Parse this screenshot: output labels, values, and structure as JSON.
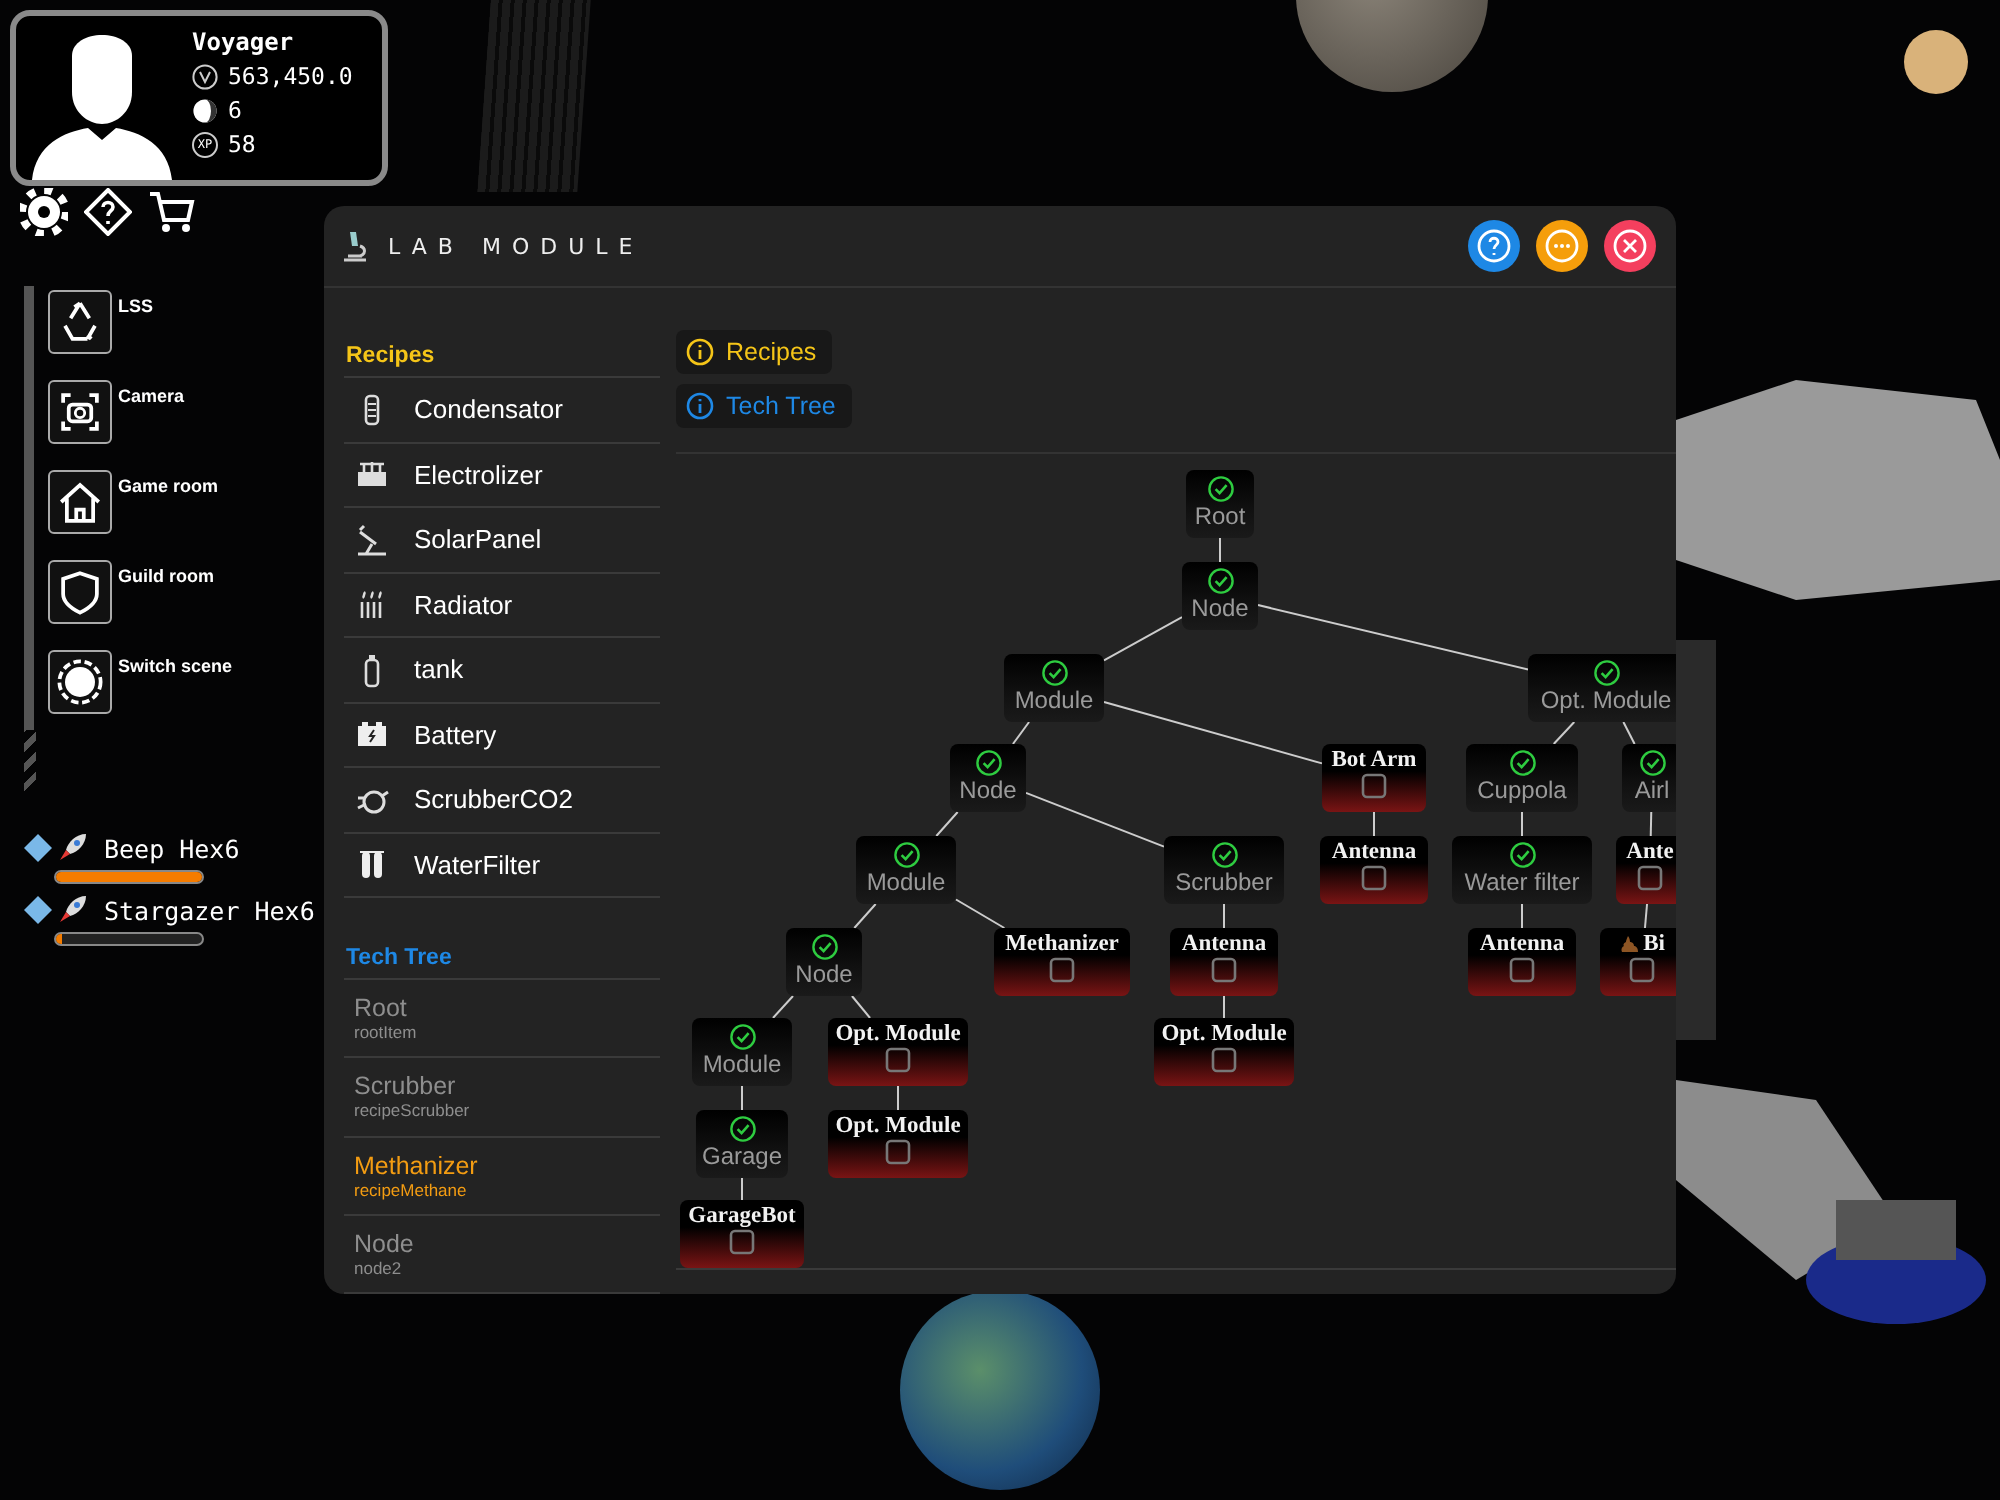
{
  "player": {
    "name": "Voyager",
    "credits": "563,450.0",
    "moons": "6",
    "xp_label": "XP",
    "xp": "58"
  },
  "menu": [
    {
      "label": "LSS"
    },
    {
      "label": "Camera"
    },
    {
      "label": "Game room"
    },
    {
      "label": "Guild room"
    },
    {
      "label": "Switch scene"
    }
  ],
  "ships": [
    {
      "name": "Beep Hex6",
      "level": 1.0
    },
    {
      "name": "Stargazer Hex6",
      "level": 0.04
    }
  ],
  "lab": {
    "title": "LAB MODULE",
    "recipes": {
      "title": "Recipes",
      "items": [
        "Condensator",
        "Electrolizer",
        "SolarPanel",
        "Radiator",
        "tank",
        "Battery",
        "ScrubberCO2",
        "WaterFilter"
      ]
    },
    "tech_list": {
      "title": "Tech Tree",
      "items": [
        {
          "name": "Root",
          "id": "rootItem",
          "selected": false
        },
        {
          "name": "Scrubber",
          "id": "recipeScrubber",
          "selected": false
        },
        {
          "name": "Methanizer",
          "id": "recipeMethane",
          "selected": true
        },
        {
          "name": "Node",
          "id": "node2",
          "selected": false
        }
      ]
    },
    "sections": [
      {
        "label": "Recipes",
        "color": "#f5c518"
      },
      {
        "label": "Tech Tree",
        "color": "#1e88e5"
      }
    ],
    "tree": {
      "label": "Root",
      "unlocked": true,
      "children": [
        {
          "label": "Node",
          "unlocked": true,
          "children": [
            {
              "label": "Module",
              "unlocked": true,
              "children": [
                {
                  "label": "Node",
                  "unlocked": true,
                  "children": [
                    {
                      "label": "Module",
                      "unlocked": true,
                      "children": [
                        {
                          "label": "Node",
                          "unlocked": true,
                          "children": [
                            {
                              "label": "Module",
                              "unlocked": true,
                              "children": [
                                {
                                  "label": "Garage",
                                  "unlocked": true,
                                  "children": [
                                    {
                                      "label": "GarageBot",
                                      "unlocked": false
                                    }
                                  ]
                                }
                              ]
                            },
                            {
                              "label": "Opt. Module",
                              "unlocked": false,
                              "children": [
                                {
                                  "label": "Opt. Module",
                                  "unlocked": false
                                }
                              ]
                            }
                          ]
                        },
                        {
                          "label": "Methanizer",
                          "unlocked": false
                        }
                      ]
                    },
                    {
                      "label": "Scrubber",
                      "unlocked": true,
                      "children": [
                        {
                          "label": "Antenna",
                          "unlocked": false,
                          "children": [
                            {
                              "label": "Opt. Module",
                              "unlocked": false
                            }
                          ]
                        }
                      ]
                    }
                  ]
                },
                {
                  "label": "Bot Arm",
                  "unlocked": false,
                  "children": [
                    {
                      "label": "Antenna",
                      "unlocked": false
                    }
                  ]
                }
              ]
            },
            {
              "label": "Opt. Module",
              "unlocked": true,
              "children": [
                {
                  "label": "Cuppola",
                  "unlocked": true,
                  "children": [
                    {
                      "label": "Water filter",
                      "unlocked": true,
                      "children": [
                        {
                          "label": "Antenna",
                          "unlocked": false
                        }
                      ]
                    }
                  ]
                },
                {
                  "label": "Airl",
                  "unlocked": true,
                  "children": [
                    {
                      "label": "Ante",
                      "unlocked": false,
                      "children": [
                        {
                          "label": "Bi",
                          "unlocked": false
                        }
                      ]
                    }
                  ]
                }
              ]
            }
          ]
        }
      ]
    }
  }
}
